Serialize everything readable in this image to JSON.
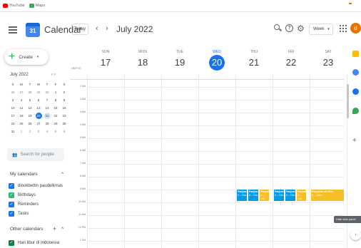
{
  "bookmarks": [
    {
      "label": "YouTube",
      "color": "#ff0000"
    },
    {
      "label": "Maps",
      "color": "#34a853"
    }
  ],
  "header": {
    "app_title": "Calendar",
    "logo_day": "31",
    "today_label": "Today",
    "prev_icon": "‹",
    "next_icon": "›",
    "month_label": "July 2022",
    "view_label": "Week",
    "help_glyph": "?",
    "settings_glyph": "⚙",
    "avatar_letter": "d"
  },
  "sidebar": {
    "create_label": "Create",
    "mini_month": "July 2022",
    "mini_nav": "‹   ›",
    "mini_weekdays": [
      "S",
      "M",
      "T",
      "W",
      "T",
      "F",
      "S"
    ],
    "mini_days": [
      [
        "26",
        "27",
        "28",
        "29",
        "30",
        "1",
        "2"
      ],
      [
        "3",
        "4",
        "5",
        "6",
        "7",
        "8",
        "9"
      ],
      [
        "10",
        "11",
        "12",
        "13",
        "14",
        "15",
        "16"
      ],
      [
        "17",
        "18",
        "19",
        "20",
        "21",
        "22",
        "23"
      ],
      [
        "24",
        "25",
        "26",
        "27",
        "28",
        "29",
        "30"
      ],
      [
        "31",
        "1",
        "2",
        "3",
        "4",
        "5",
        "6"
      ]
    ],
    "search_people": "Search for people",
    "my_calendars_label": "My calendars",
    "my_calendars": [
      {
        "label": "dinokbettin paudelkmas",
        "color": "#1a73e8"
      },
      {
        "label": "Birthdays",
        "color": "#33b679"
      },
      {
        "label": "Reminders",
        "color": "#1a73e8"
      },
      {
        "label": "Tasks",
        "color": "#1a73e8"
      }
    ],
    "other_calendars_label": "Other calendars",
    "other_calendars": [
      {
        "label": "Hari libur di Indonesia",
        "color": "#0b8043"
      }
    ]
  },
  "week": {
    "timezone": "GMT+07",
    "days": [
      {
        "name": "SUN",
        "date": "17"
      },
      {
        "name": "MON",
        "date": "18"
      },
      {
        "name": "TUE",
        "date": "19"
      },
      {
        "name": "WED",
        "date": "20",
        "today": true
      },
      {
        "name": "THU",
        "date": "21"
      },
      {
        "name": "FRI",
        "date": "22"
      },
      {
        "name": "SAT",
        "date": "23"
      }
    ],
    "hours": [
      "1 AM",
      "2 AM",
      "3 AM",
      "4 AM",
      "5 AM",
      "6 AM",
      "7 AM",
      "8 AM",
      "9 AM",
      "10 AM",
      "11 AM",
      "12 PM",
      "1 PM"
    ]
  },
  "events": [
    {
      "title": "Panjual",
      "time": "9 – 10a",
      "day": 4,
      "slot": 0,
      "color": "#039be5"
    },
    {
      "title": "Panjual",
      "time": "9 – 10a",
      "day": 4,
      "slot": 1,
      "color": "#039be5"
    },
    {
      "title": "Panjual",
      "time": "9 – 10a",
      "day": 4,
      "slot": 2,
      "color": "#f6bf26"
    },
    {
      "title": "Panjual",
      "time": "9 – 10a",
      "day": 5,
      "slot": 0,
      "color": "#039be5"
    },
    {
      "title": "Panjual",
      "time": "9 – 10a",
      "day": 5,
      "slot": 1,
      "color": "#039be5"
    },
    {
      "title": "Panjual",
      "time": "9 – 10a",
      "day": 5,
      "slot": 2,
      "color": "#f6bf26"
    },
    {
      "title": "Penjualan ah Oleh",
      "time": "9 – 10am",
      "day": 6,
      "slot": -1,
      "color": "#f6bf26"
    }
  ],
  "right_panel": {
    "tooltip": "Hide side panel",
    "expand_icon": "›"
  }
}
